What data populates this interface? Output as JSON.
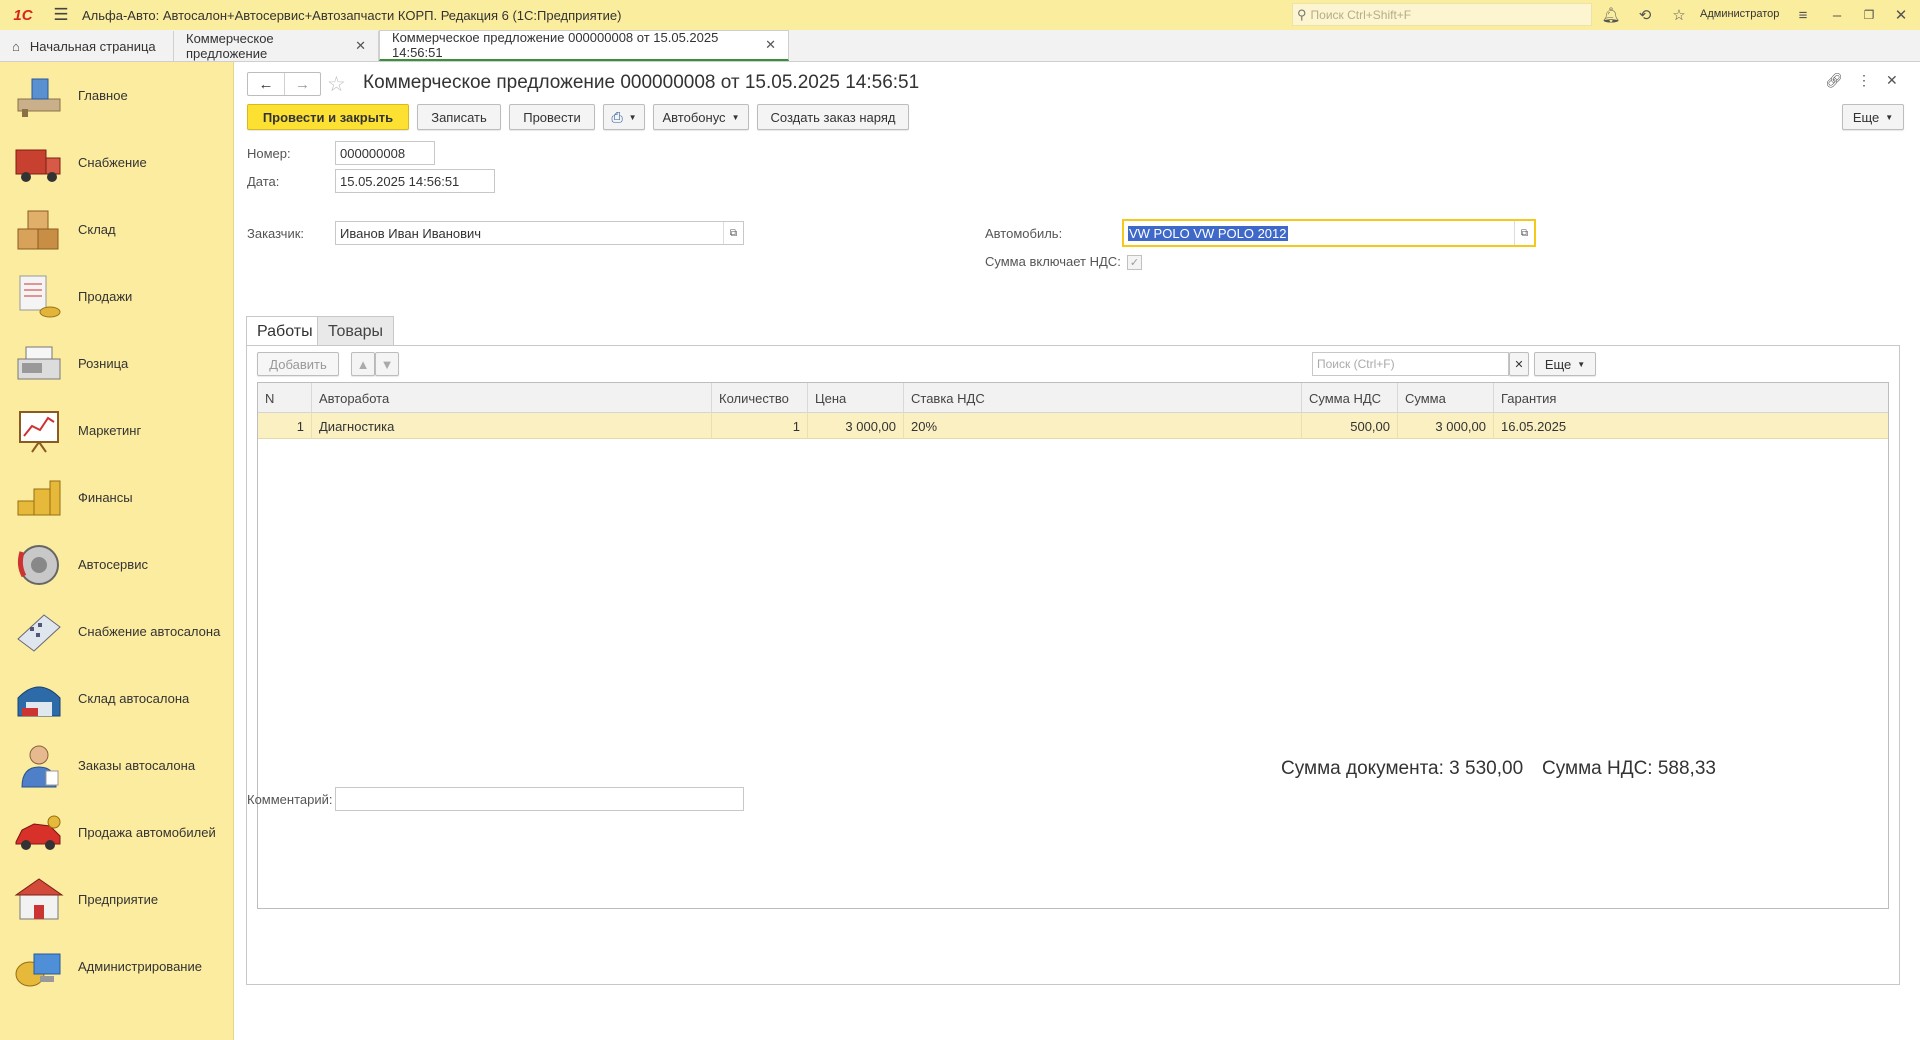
{
  "app": {
    "logo": "1С",
    "title": "Альфа-Авто: Автосалон+Автосервис+Автозапчасти КОРП. Редакция 6  (1С:Предприятие)",
    "search_placeholder": "Поиск Ctrl+Shift+F",
    "user": "Администратор"
  },
  "page_tabs": [
    {
      "label": "Начальная страница"
    },
    {
      "label": "Коммерческое предложение"
    },
    {
      "label": "Коммерческое предложение 000000008 от 15.05.2025 14:56:51"
    }
  ],
  "sidebar": {
    "items": [
      {
        "label": "Главное",
        "icon": "desk-icon"
      },
      {
        "label": "Снабжение",
        "icon": "truck-icon"
      },
      {
        "label": "Склад",
        "icon": "boxes-icon"
      },
      {
        "label": "Продажи",
        "icon": "sales-icon"
      },
      {
        "label": "Розница",
        "icon": "cash-register-icon"
      },
      {
        "label": "Маркетинг",
        "icon": "chart-board-icon"
      },
      {
        "label": "Финансы",
        "icon": "coins-icon"
      },
      {
        "label": "Автосервис",
        "icon": "brake-disc-icon"
      },
      {
        "label": "Снабжение автосалона",
        "icon": "calculator-icon"
      },
      {
        "label": "Склад автосалона",
        "icon": "garage-icon"
      },
      {
        "label": "Заказы автосалона",
        "icon": "person-icon"
      },
      {
        "label": "Продажа автомобилей",
        "icon": "red-car-icon"
      },
      {
        "label": "Предприятие",
        "icon": "building-icon"
      },
      {
        "label": "Администрирование",
        "icon": "computer-icon"
      }
    ]
  },
  "document": {
    "title": "Коммерческое предложение 000000008 от 15.05.2025 14:56:51"
  },
  "toolbar": {
    "post_close": "Провести и закрыть",
    "save": "Записать",
    "post": "Провести",
    "autobonus": "Автобонус",
    "create_order": "Создать заказ наряд",
    "more": "Еще"
  },
  "form": {
    "number_label": "Номер:",
    "number_value": "000000008",
    "date_label": "Дата:",
    "date_value": "15.05.2025 14:56:51",
    "customer_label": "Заказчик:",
    "customer_value": "Иванов Иван Иванович",
    "car_label": "Автомобиль:",
    "car_value": "VW POLO VW POLO 2012",
    "vat_included_label": "Сумма включает НДС:",
    "vat_included": true,
    "comment_label": "Комментарий:",
    "comment_value": ""
  },
  "inner_tabs": [
    {
      "label": "Работы"
    },
    {
      "label": "Товары"
    }
  ],
  "table_toolbar": {
    "add": "Добавить",
    "search_placeholder": "Поиск (Ctrl+F)",
    "more": "Еще"
  },
  "table": {
    "columns": [
      "N",
      "Авторабота",
      "Количество",
      "Цена",
      "Ставка НДС",
      "Сумма НДС",
      "Сумма",
      "Гарантия"
    ],
    "rows": [
      {
        "n": "1",
        "work": "Диагностика",
        "qty": "1",
        "price": "3 000,00",
        "vat_rate": "20%",
        "vat_sum": "500,00",
        "sum": "3 000,00",
        "warranty": "16.05.2025"
      }
    ]
  },
  "totals": {
    "doc_sum": "Сумма документа: 3 530,00",
    "vat_sum": "Сумма НДС: 588,33"
  }
}
